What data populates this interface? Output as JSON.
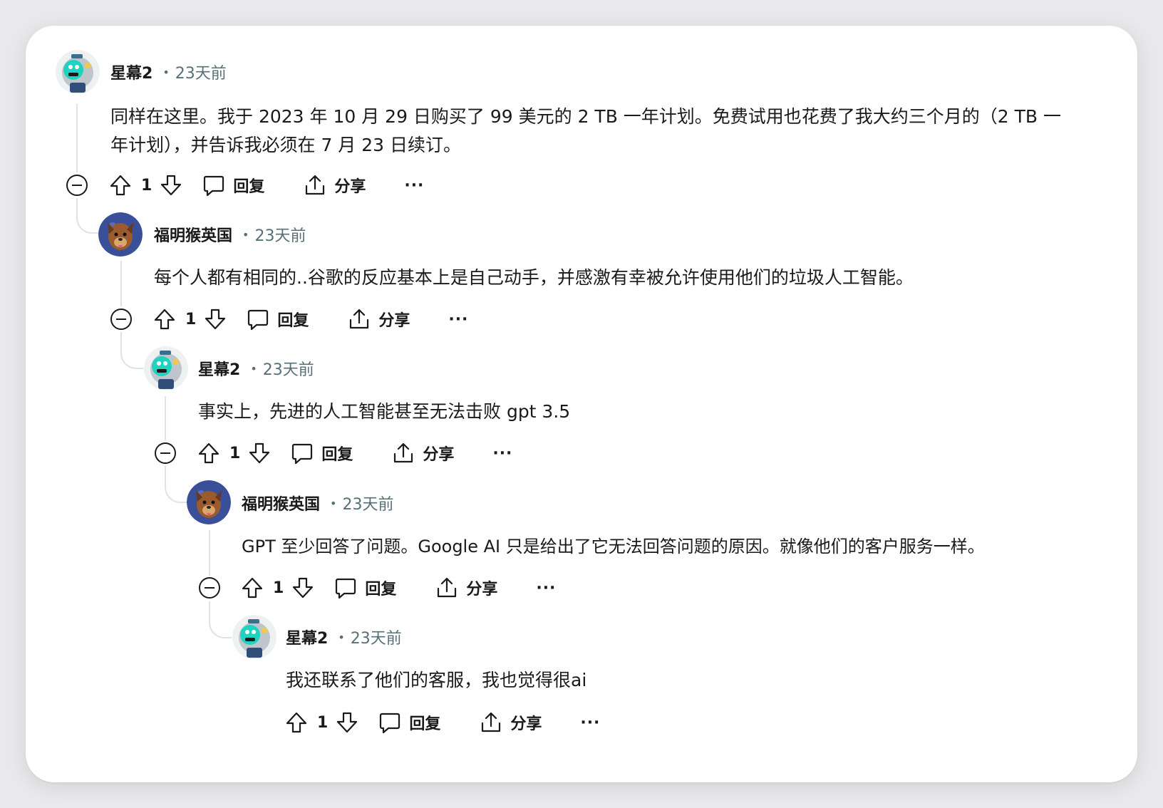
{
  "labels": {
    "reply": "回复",
    "share": "分享",
    "more": "···",
    "meta_separator": "•"
  },
  "comments": [
    {
      "author": "星幕2",
      "time": "23天前",
      "text": "同样在这里。我于 2023 年 10 月 29 日购买了 99 美元的 2 TB 一年计划。免费试用也花费了我大约三个月的（2 TB 一年计划），并告诉我必须在 7 月 23 日续订。",
      "votes": "1",
      "avatar": "robot-avatar"
    },
    {
      "author": "福明猴英国",
      "time": "23天前",
      "text": "每个人都有相同的..谷歌的反应基本上是自己动手，并感激有幸被允许使用他们的垃圾人工智能。",
      "votes": "1",
      "avatar": "dog-avatar"
    },
    {
      "author": "星幕2",
      "time": "23天前",
      "text": "事实上，先进的人工智能甚至无法击败 gpt 3.5",
      "votes": "1",
      "avatar": "robot-avatar"
    },
    {
      "author": "福明猴英国",
      "time": "23天前",
      "text": "GPT 至少回答了问题。Google AI 只是给出了它无法回答问题的原因。就像他们的客户服务一样。",
      "votes": "1",
      "avatar": "dog-avatar"
    },
    {
      "author": "星幕2",
      "time": "23天前",
      "text": "我还联系了他们的客服，我也觉得很ai",
      "votes": "1",
      "avatar": "robot-avatar"
    }
  ],
  "colors": {
    "card": "#ffffff",
    "background": "#e9e9ec",
    "thread_line": "#dfe3e6",
    "meta": "#576f76",
    "text": "#1a1a1b"
  }
}
